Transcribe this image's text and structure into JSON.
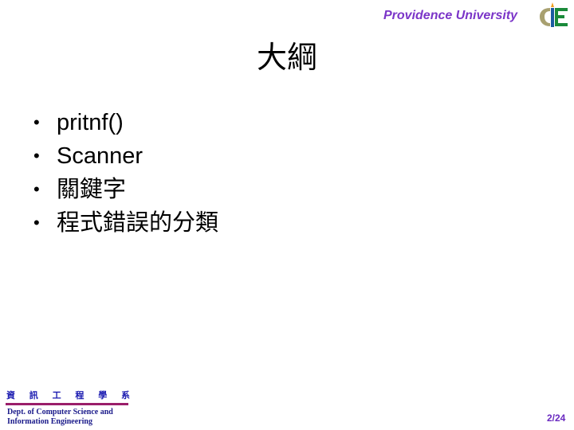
{
  "header": {
    "university": "Providence University",
    "logo_icon": "csie-logo-icon",
    "brand_color": "#7b35c8"
  },
  "slide": {
    "title": "大綱",
    "bullets": [
      {
        "marker": "•",
        "text": "pritnf()"
      },
      {
        "marker": "•",
        "text": "Scanner"
      },
      {
        "marker": "•",
        "text": "關鍵字"
      },
      {
        "marker": "•",
        "text": "程式錯誤的分類"
      }
    ]
  },
  "footer": {
    "dept_chars": [
      "資",
      "訊",
      "工",
      "程",
      "學",
      "系"
    ],
    "dept_en_line1": "Dept. of Computer Science and",
    "dept_en_line2": "Information Engineering",
    "page_number": "2/24"
  }
}
